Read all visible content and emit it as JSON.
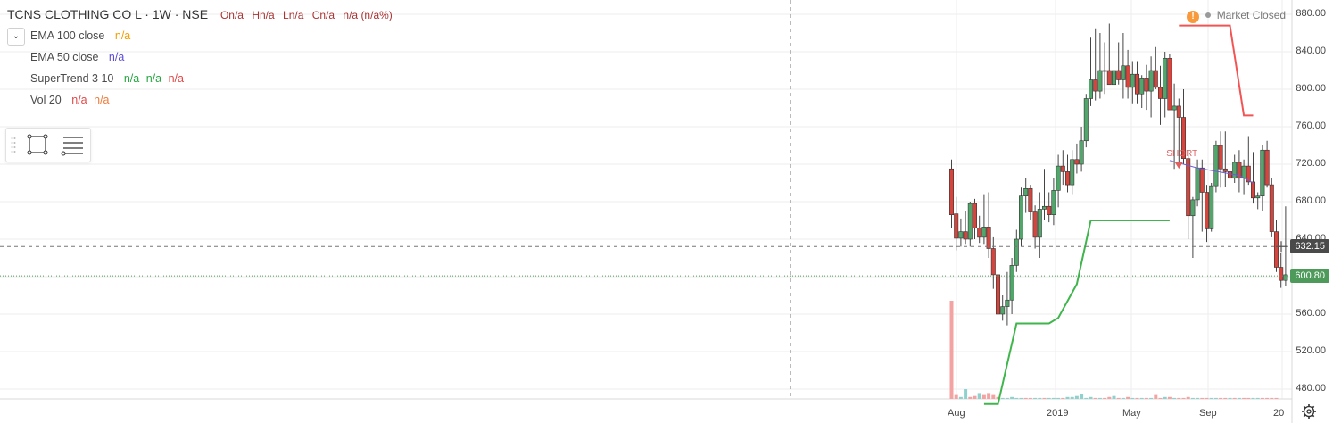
{
  "header": {
    "symbol_title": "TCNS CLOTHING CO L · 1W · NSE",
    "ohlc": {
      "open": "On/a",
      "high": "Hn/a",
      "low": "Ln/a",
      "close": "Cn/a",
      "change": "n/a (n/a%)"
    }
  },
  "indicators": [
    {
      "label": "EMA 100 close",
      "values": [
        "n/a"
      ],
      "color": "#f0a000"
    },
    {
      "label": "EMA 50 close",
      "values": [
        "n/a"
      ],
      "color": "#5b4cd8"
    },
    {
      "label": "SuperTrend 3 10",
      "values": [
        "n/a",
        "n/a",
        "n/a"
      ],
      "colors": [
        "#26a641",
        "#26a641",
        "#e04848"
      ]
    },
    {
      "label": "Vol 20",
      "values": [
        "n/a",
        "n/a"
      ],
      "colors": [
        "#e04848",
        "#f07a3a"
      ]
    }
  ],
  "toolbox": {
    "tools": [
      "rectangle-tool-icon",
      "lines-menu-icon"
    ]
  },
  "market_status": {
    "text": "Market Closed",
    "warning_icon": "!"
  },
  "y_axis": {
    "ticks": [
      "880.00",
      "840.00",
      "800.00",
      "760.00",
      "720.00",
      "680.00",
      "640.00",
      "600.00",
      "560.00",
      "520.00",
      "480.00"
    ]
  },
  "x_axis": {
    "ticks": [
      "Aug",
      "2019",
      "May",
      "Sep",
      "20"
    ]
  },
  "price_tags": {
    "crosshair": {
      "value": "632.15",
      "color": "#4a4a4a"
    },
    "last": {
      "value": "600.80",
      "color": "#4d9a5b"
    }
  },
  "chart_data": {
    "type": "candlestick",
    "y_range": [
      440,
      890
    ],
    "candle_colors": {
      "up": "#53a66b",
      "down": "#d6453d"
    },
    "volume_colors": {
      "up": "#8fd1cd",
      "down": "#f4a3a3"
    },
    "candles": [
      {
        "o": 715,
        "h": 725,
        "l": 652,
        "c": 666
      },
      {
        "o": 667,
        "h": 685,
        "l": 628,
        "c": 641
      },
      {
        "o": 641,
        "h": 662,
        "l": 632,
        "c": 648
      },
      {
        "o": 648,
        "h": 670,
        "l": 635,
        "c": 640
      },
      {
        "o": 640,
        "h": 680,
        "l": 632,
        "c": 678
      },
      {
        "o": 678,
        "h": 683,
        "l": 640,
        "c": 652
      },
      {
        "o": 652,
        "h": 665,
        "l": 636,
        "c": 642
      },
      {
        "o": 642,
        "h": 688,
        "l": 635,
        "c": 653
      },
      {
        "o": 653,
        "h": 690,
        "l": 620,
        "c": 630
      },
      {
        "o": 630,
        "h": 642,
        "l": 587,
        "c": 602
      },
      {
        "o": 602,
        "h": 612,
        "l": 550,
        "c": 560
      },
      {
        "o": 560,
        "h": 580,
        "l": 553,
        "c": 568
      },
      {
        "o": 568,
        "h": 605,
        "l": 548,
        "c": 575
      },
      {
        "o": 575,
        "h": 620,
        "l": 560,
        "c": 612
      },
      {
        "o": 612,
        "h": 650,
        "l": 605,
        "c": 640
      },
      {
        "o": 640,
        "h": 695,
        "l": 632,
        "c": 686
      },
      {
        "o": 686,
        "h": 705,
        "l": 668,
        "c": 694
      },
      {
        "o": 694,
        "h": 698,
        "l": 660,
        "c": 669
      },
      {
        "o": 669,
        "h": 676,
        "l": 630,
        "c": 642
      },
      {
        "o": 642,
        "h": 690,
        "l": 620,
        "c": 672
      },
      {
        "o": 672,
        "h": 715,
        "l": 660,
        "c": 675
      },
      {
        "o": 675,
        "h": 690,
        "l": 658,
        "c": 666
      },
      {
        "o": 666,
        "h": 705,
        "l": 655,
        "c": 692
      },
      {
        "o": 692,
        "h": 730,
        "l": 674,
        "c": 718
      },
      {
        "o": 718,
        "h": 735,
        "l": 698,
        "c": 712
      },
      {
        "o": 712,
        "h": 730,
        "l": 690,
        "c": 698
      },
      {
        "o": 698,
        "h": 735,
        "l": 688,
        "c": 725
      },
      {
        "o": 725,
        "h": 742,
        "l": 710,
        "c": 720
      },
      {
        "o": 720,
        "h": 760,
        "l": 712,
        "c": 745
      },
      {
        "o": 745,
        "h": 795,
        "l": 738,
        "c": 790
      },
      {
        "o": 790,
        "h": 855,
        "l": 782,
        "c": 810
      },
      {
        "o": 810,
        "h": 865,
        "l": 788,
        "c": 798
      },
      {
        "o": 798,
        "h": 860,
        "l": 790,
        "c": 820
      },
      {
        "o": 820,
        "h": 850,
        "l": 795,
        "c": 820
      },
      {
        "o": 820,
        "h": 870,
        "l": 805,
        "c": 805
      },
      {
        "o": 805,
        "h": 842,
        "l": 760,
        "c": 820
      },
      {
        "o": 820,
        "h": 850,
        "l": 805,
        "c": 810
      },
      {
        "o": 810,
        "h": 860,
        "l": 790,
        "c": 825
      },
      {
        "o": 825,
        "h": 842,
        "l": 790,
        "c": 802
      },
      {
        "o": 802,
        "h": 830,
        "l": 785,
        "c": 816
      },
      {
        "o": 816,
        "h": 830,
        "l": 785,
        "c": 795
      },
      {
        "o": 795,
        "h": 815,
        "l": 780,
        "c": 812
      },
      {
        "o": 812,
        "h": 826,
        "l": 778,
        "c": 798
      },
      {
        "o": 798,
        "h": 835,
        "l": 770,
        "c": 820
      },
      {
        "o": 820,
        "h": 845,
        "l": 800,
        "c": 802
      },
      {
        "o": 802,
        "h": 825,
        "l": 762,
        "c": 790
      },
      {
        "o": 790,
        "h": 840,
        "l": 770,
        "c": 833
      },
      {
        "o": 833,
        "h": 838,
        "l": 790,
        "c": 778
      },
      {
        "o": 778,
        "h": 806,
        "l": 715,
        "c": 782
      },
      {
        "o": 782,
        "h": 790,
        "l": 722,
        "c": 770
      },
      {
        "o": 770,
        "h": 800,
        "l": 720,
        "c": 726
      },
      {
        "o": 726,
        "h": 735,
        "l": 640,
        "c": 665
      },
      {
        "o": 665,
        "h": 685,
        "l": 620,
        "c": 682
      },
      {
        "o": 682,
        "h": 725,
        "l": 675,
        "c": 716
      },
      {
        "o": 716,
        "h": 725,
        "l": 648,
        "c": 690
      },
      {
        "o": 690,
        "h": 698,
        "l": 637,
        "c": 651
      },
      {
        "o": 651,
        "h": 700,
        "l": 648,
        "c": 697
      },
      {
        "o": 697,
        "h": 745,
        "l": 690,
        "c": 740
      },
      {
        "o": 740,
        "h": 755,
        "l": 695,
        "c": 715
      },
      {
        "o": 715,
        "h": 755,
        "l": 696,
        "c": 712
      },
      {
        "o": 712,
        "h": 730,
        "l": 692,
        "c": 705
      },
      {
        "o": 705,
        "h": 730,
        "l": 700,
        "c": 722
      },
      {
        "o": 722,
        "h": 735,
        "l": 690,
        "c": 705
      },
      {
        "o": 705,
        "h": 725,
        "l": 688,
        "c": 718
      },
      {
        "o": 718,
        "h": 750,
        "l": 698,
        "c": 701
      },
      {
        "o": 701,
        "h": 733,
        "l": 678,
        "c": 684
      },
      {
        "o": 684,
        "h": 690,
        "l": 672,
        "c": 686
      },
      {
        "o": 686,
        "h": 740,
        "l": 670,
        "c": 735
      },
      {
        "o": 735,
        "h": 745,
        "l": 695,
        "c": 698
      },
      {
        "o": 698,
        "h": 705,
        "l": 642,
        "c": 648
      },
      {
        "o": 648,
        "h": 660,
        "l": 605,
        "c": 610
      },
      {
        "o": 610,
        "h": 625,
        "l": 588,
        "c": 596
      },
      {
        "o": 596,
        "h": 675,
        "l": 590,
        "c": 602
      }
    ],
    "volumes": [
      {
        "v": 100,
        "up": false
      },
      {
        "v": 4,
        "up": false
      },
      {
        "v": 2,
        "up": true
      },
      {
        "v": 10,
        "up": true
      },
      {
        "v": 2,
        "up": false
      },
      {
        "v": 3,
        "up": false
      },
      {
        "v": 6,
        "up": true
      },
      {
        "v": 4,
        "up": false
      },
      {
        "v": 6,
        "up": false
      },
      {
        "v": 4,
        "up": false
      },
      {
        "v": 2,
        "up": false
      },
      {
        "v": 1,
        "up": true
      },
      {
        "v": 1,
        "up": true
      },
      {
        "v": 2,
        "up": true
      },
      {
        "v": 1,
        "up": true
      },
      {
        "v": 1,
        "up": true
      },
      {
        "v": 1,
        "up": false
      },
      {
        "v": 1,
        "up": false
      },
      {
        "v": 1,
        "up": true
      },
      {
        "v": 1,
        "up": true
      },
      {
        "v": 1,
        "up": false
      },
      {
        "v": 1,
        "up": true
      },
      {
        "v": 1,
        "up": true
      },
      {
        "v": 1,
        "up": true
      },
      {
        "v": 1,
        "up": false
      },
      {
        "v": 2,
        "up": true
      },
      {
        "v": 2,
        "up": true
      },
      {
        "v": 3,
        "up": true
      },
      {
        "v": 5,
        "up": true
      },
      {
        "v": 1,
        "up": true
      },
      {
        "v": 2,
        "up": true
      },
      {
        "v": 1,
        "up": false
      },
      {
        "v": 1,
        "up": true
      },
      {
        "v": 1,
        "up": false
      },
      {
        "v": 2,
        "up": false
      },
      {
        "v": 3,
        "up": true
      },
      {
        "v": 1,
        "up": false
      },
      {
        "v": 1,
        "up": true
      },
      {
        "v": 2,
        "up": false
      },
      {
        "v": 1,
        "up": true
      },
      {
        "v": 1,
        "up": false
      },
      {
        "v": 1,
        "up": true
      },
      {
        "v": 1,
        "up": false
      },
      {
        "v": 1,
        "up": true
      },
      {
        "v": 4,
        "up": false
      },
      {
        "v": 1,
        "up": false
      },
      {
        "v": 2,
        "up": true
      },
      {
        "v": 2,
        "up": false
      },
      {
        "v": 1,
        "up": true
      },
      {
        "v": 1,
        "up": false
      },
      {
        "v": 1,
        "up": false
      },
      {
        "v": 2,
        "up": false
      },
      {
        "v": 1,
        "up": true
      },
      {
        "v": 1,
        "up": true
      },
      {
        "v": 1,
        "up": false
      },
      {
        "v": 1,
        "up": false
      },
      {
        "v": 1,
        "up": true
      },
      {
        "v": 1,
        "up": true
      },
      {
        "v": 1,
        "up": false
      },
      {
        "v": 1,
        "up": false
      },
      {
        "v": 1,
        "up": true
      },
      {
        "v": 1,
        "up": false
      },
      {
        "v": 1,
        "up": true
      },
      {
        "v": 1,
        "up": false
      },
      {
        "v": 1,
        "up": false
      },
      {
        "v": 1,
        "up": true
      },
      {
        "v": 1,
        "up": true
      },
      {
        "v": 1,
        "up": false
      },
      {
        "v": 1,
        "up": false
      },
      {
        "v": 1,
        "up": false
      },
      {
        "v": 1,
        "up": false
      }
    ],
    "supertrend_up": [
      [
        7,
        464
      ],
      [
        10,
        464
      ],
      [
        14,
        550
      ],
      [
        21,
        550
      ],
      [
        23,
        556
      ],
      [
        27,
        592
      ],
      [
        30,
        660
      ],
      [
        47,
        660
      ]
    ],
    "supertrend_down": [
      [
        49,
        868
      ],
      [
        60,
        868
      ],
      [
        63,
        772
      ],
      [
        65,
        772
      ]
    ],
    "ema50": [
      [
        47,
        724
      ],
      [
        53,
        716
      ],
      [
        62,
        708
      ],
      [
        65,
        700
      ]
    ],
    "annotations": [
      {
        "text": "SHORT",
        "color": "#e06060",
        "index": 49,
        "price": 717
      }
    ]
  }
}
